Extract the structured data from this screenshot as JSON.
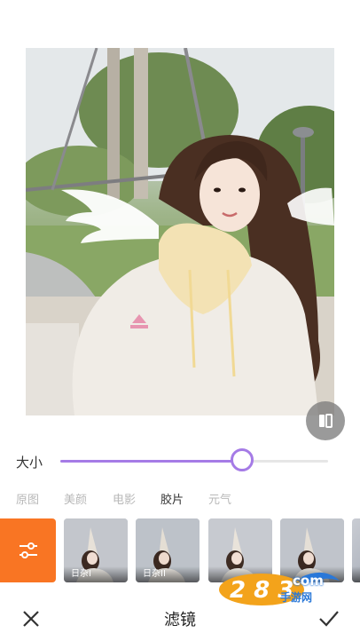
{
  "photo": {
    "description_icon": "photo-preview"
  },
  "compare": {
    "icon": "compare-icon"
  },
  "size": {
    "label": "大小",
    "value": 0.68
  },
  "tabs": [
    {
      "label": "原图"
    },
    {
      "label": "美颜"
    },
    {
      "label": "电影"
    },
    {
      "label": "胶片",
      "active": true
    },
    {
      "label": "元气"
    }
  ],
  "filters": [
    {
      "label": "日杂I"
    },
    {
      "label": "日杂II"
    },
    {
      "label": ""
    },
    {
      "label": ""
    },
    {
      "label": ""
    }
  ],
  "watermark": {
    "text": "com",
    "sub": "手游网"
  },
  "bottom": {
    "title": "滤镜",
    "close_icon": "close-icon",
    "confirm_icon": "check-icon"
  },
  "colors": {
    "accent": "#a57be6",
    "orange": "#f97523"
  }
}
